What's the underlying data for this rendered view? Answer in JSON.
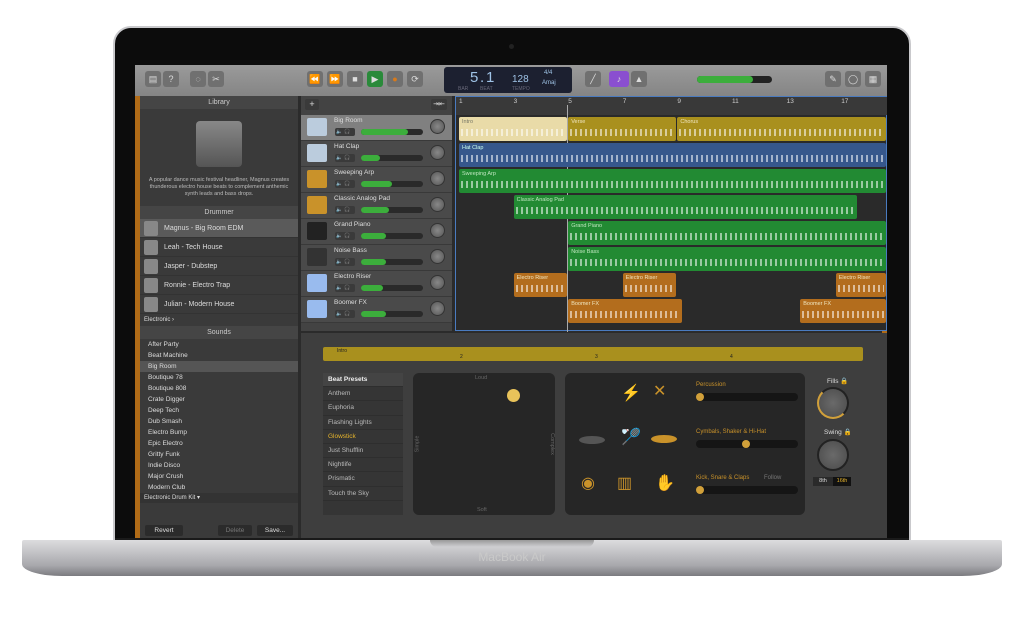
{
  "device": {
    "brand": "MacBook Air"
  },
  "toolbar": {
    "buttons": [
      "library-icon",
      "help-icon",
      "smart-controls-icon",
      "editors-icon"
    ],
    "transport": {
      "rewind": "⏪",
      "forward": "⏩",
      "stop": "■",
      "play": "▶",
      "record": "●",
      "cycle": "⟳"
    },
    "lcd": {
      "bar": "5",
      "beat": "1",
      "bar_label": "BAR",
      "beat_label": "BEAT",
      "tempo": "128",
      "tempo_label": "TEMPO",
      "time_signature": "4/4",
      "key": "Amaj"
    },
    "master_volume": 0.75,
    "accent": "#8a4fd0"
  },
  "library": {
    "title": "Library",
    "description": "A popular dance music festival headliner, Magnus creates thunderous electro house beats to complement anthemic synth leads and bass drops.",
    "drummer_header": "Drummer",
    "drummers": [
      "Magnus - Big Room EDM",
      "Leah - Tech House",
      "Jasper - Dubstep",
      "Ronnie - Electro Trap",
      "Julian - Modern House"
    ],
    "genre": "Electronic  ›",
    "sounds_header": "Sounds",
    "sounds": [
      "After Party",
      "Beat Machine",
      "Big Room",
      "Boutique 78",
      "Boutique 808",
      "Crate Digger",
      "Deep Tech",
      "Dub Smash",
      "Electro Bump",
      "Epic Electro",
      "Gritty Funk",
      "Indie Disco",
      "Major Crush",
      "Modern Club"
    ],
    "selected_sound": "Big Room",
    "kit": "Electronic Drum Kit  ▾",
    "revert": "Revert",
    "delete": "Delete",
    "save": "Save..."
  },
  "tracks": [
    {
      "name": "Big Room",
      "volume": 0.75
    },
    {
      "name": "Hat Clap",
      "volume": 0.3
    },
    {
      "name": "Sweeping Arp",
      "volume": 0.5
    },
    {
      "name": "Classic Analog Pad",
      "volume": 0.45
    },
    {
      "name": "Grand Piano",
      "volume": 0.4
    },
    {
      "name": "Noise Bass",
      "volume": 0.4
    },
    {
      "name": "Electro Riser",
      "volume": 0.35
    },
    {
      "name": "Boomer FX",
      "volume": 0.4
    }
  ],
  "timeline": {
    "bars": [
      "1",
      "3",
      "5",
      "7",
      "9",
      "11",
      "13",
      "17"
    ],
    "regions": {
      "intro": "Intro",
      "verse": "Verse",
      "chorus": "Chorus",
      "hat": "Hat Clap",
      "arp": "Sweeping Arp",
      "pad": "Classic Analog Pad",
      "piano": "Grand Piano",
      "bass": "Noise Bass",
      "riser": "Electro Riser",
      "boomer": "Boomer FX"
    }
  },
  "editor": {
    "region": "Intro",
    "ruler": [
      "1",
      "2",
      "3",
      "4"
    ],
    "presets_header": "Beat Presets",
    "presets": [
      "Anthem",
      "Euphoria",
      "Flashing Lights",
      "Glowstick",
      "Just Shufflin",
      "Nightlife",
      "Prismatic",
      "Touch the Sky"
    ],
    "active_preset": "Glowstick",
    "xy": {
      "top": "Loud",
      "bottom": "Soft",
      "left": "Simple",
      "right": "Complex",
      "loudness": 0.8,
      "complexity": 0.7
    },
    "percussion": {
      "label": "Percussion",
      "value": 0.0
    },
    "cymbals": {
      "label": "Cymbals, Shaker & Hi-Hat",
      "value": 0.5
    },
    "kick": {
      "label": "Kick, Snare & Claps",
      "value": 0.0,
      "follow": "Follow"
    },
    "fills": "Fills 🔒",
    "swing": "Swing 🔒",
    "note_8": "8th",
    "note_16": "16th"
  }
}
